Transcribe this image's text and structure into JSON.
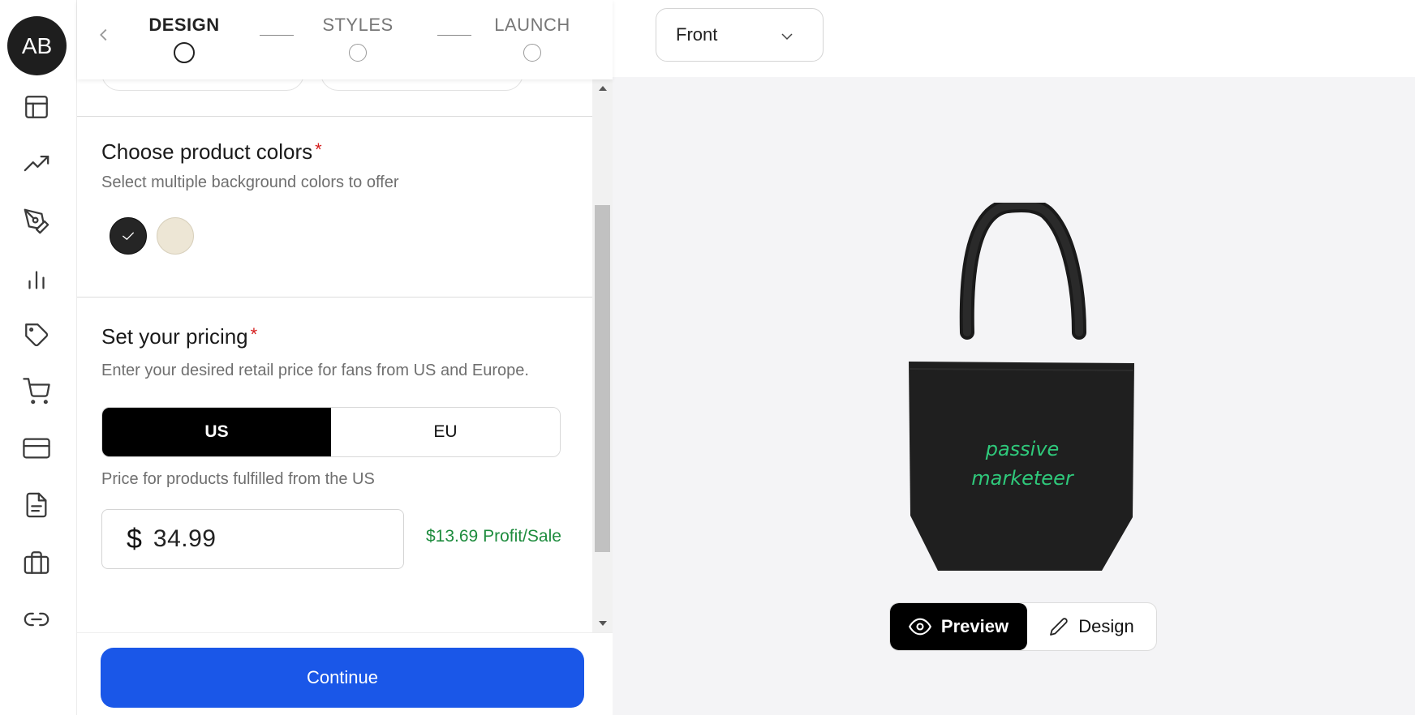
{
  "user": {
    "initials": "AB"
  },
  "sidebar": {
    "icons": [
      "layout-icon",
      "trending-up-icon",
      "pen-tool-icon",
      "bar-chart-icon",
      "tag-icon",
      "cart-icon",
      "credit-card-icon",
      "document-icon",
      "briefcase-icon",
      "link-icon"
    ]
  },
  "stepper": {
    "steps": [
      {
        "label": "DESIGN",
        "active": true
      },
      {
        "label": "STYLES",
        "active": false
      },
      {
        "label": "LAUNCH",
        "active": false
      }
    ]
  },
  "colors_section": {
    "title": "Choose product colors",
    "required_mark": "*",
    "subtitle": "Select multiple background colors to offer",
    "swatches": [
      {
        "color": "#252525",
        "selected": true
      },
      {
        "color": "#ede6d5",
        "selected": false
      }
    ]
  },
  "pricing_section": {
    "title": "Set your pricing",
    "required_mark": "*",
    "subtitle": "Enter your desired retail price for fans from US and Europe.",
    "regions": [
      {
        "label": "US",
        "active": true
      },
      {
        "label": "EU",
        "active": false
      }
    ],
    "fulfillment_note": "Price for products fulfilled from the US",
    "currency_symbol": "$",
    "price": "34.99",
    "profit": "$13.69 Profit/Sale"
  },
  "footer": {
    "continue_label": "Continue"
  },
  "preview": {
    "view_select": "Front",
    "product_text_line1": "passive",
    "product_text_line2": "marketeer",
    "product_color": "#1f1f1f",
    "text_color": "#2fc97b",
    "modes": [
      {
        "label": "Preview",
        "active": true
      },
      {
        "label": "Design",
        "active": false
      }
    ]
  },
  "colors": {
    "accent": "#1a57e8",
    "profit": "#1e8c3e",
    "required": "#d51d1d"
  }
}
